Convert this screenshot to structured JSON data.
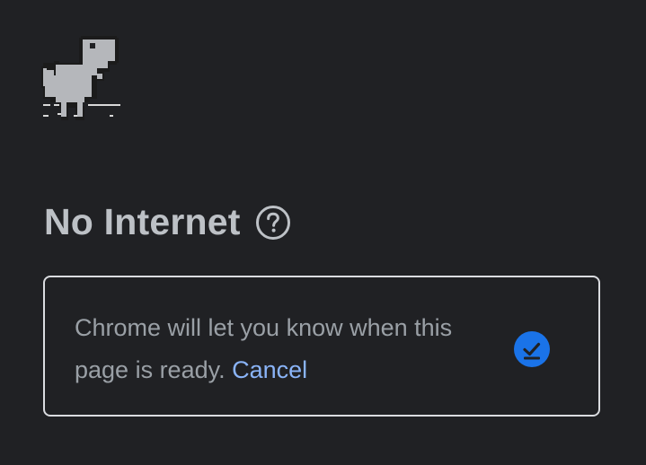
{
  "icons": {
    "dino": "dino-icon",
    "help": "help-circle-icon",
    "status": "offline-download-scheduled-icon"
  },
  "colors": {
    "background": "#202124",
    "title": "#bdc1c6",
    "body_text": "#9aa0a6",
    "link": "#8ab4f8",
    "accent": "#1a73e8",
    "card_border": "#dadce0"
  },
  "error": {
    "title": "No Internet"
  },
  "notice": {
    "message": "Chrome will let you know when this page is ready.",
    "cancel_label": "Cancel"
  }
}
